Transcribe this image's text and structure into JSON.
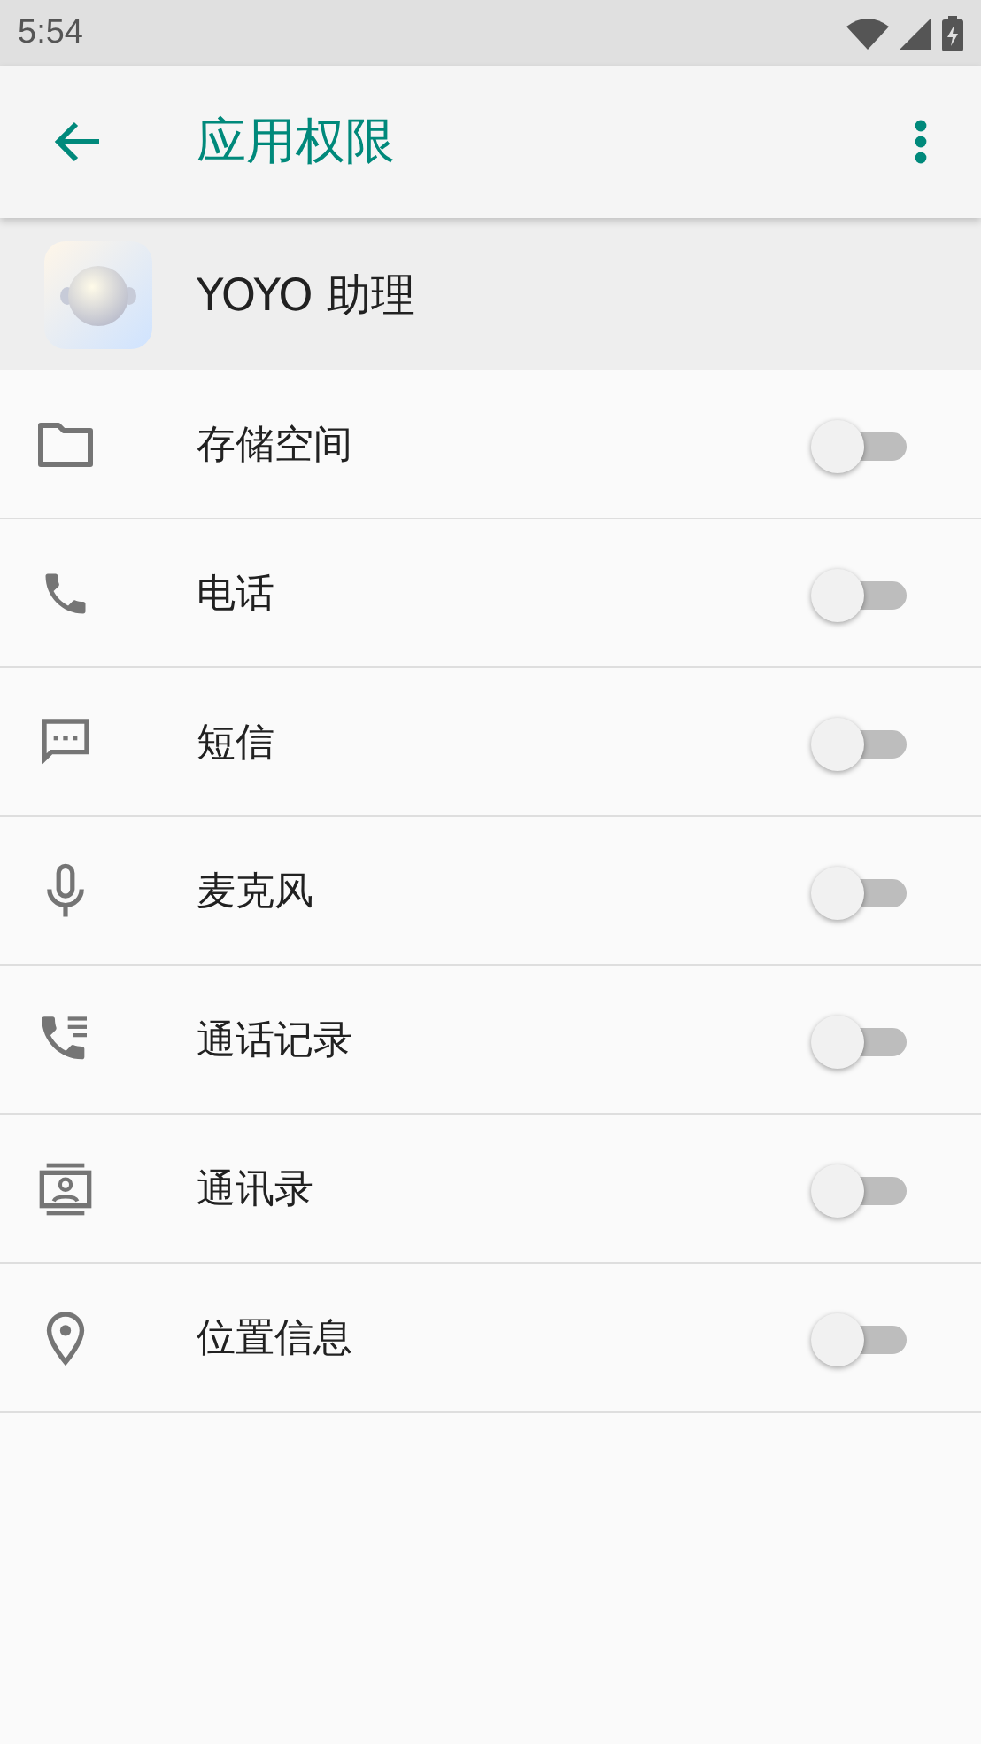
{
  "status_bar": {
    "time": "5:54"
  },
  "app_bar": {
    "title": "应用权限"
  },
  "app": {
    "name": "YOYO 助理"
  },
  "permissions": [
    {
      "kind": "storage",
      "label": "存储空间",
      "on": false
    },
    {
      "kind": "phone",
      "label": "电话",
      "on": false
    },
    {
      "kind": "sms",
      "label": "短信",
      "on": false
    },
    {
      "kind": "microphone",
      "label": "麦克风",
      "on": false
    },
    {
      "kind": "call_log",
      "label": "通话记录",
      "on": false
    },
    {
      "kind": "contacts",
      "label": "通讯录",
      "on": false
    },
    {
      "kind": "location",
      "label": "位置信息",
      "on": false
    }
  ]
}
